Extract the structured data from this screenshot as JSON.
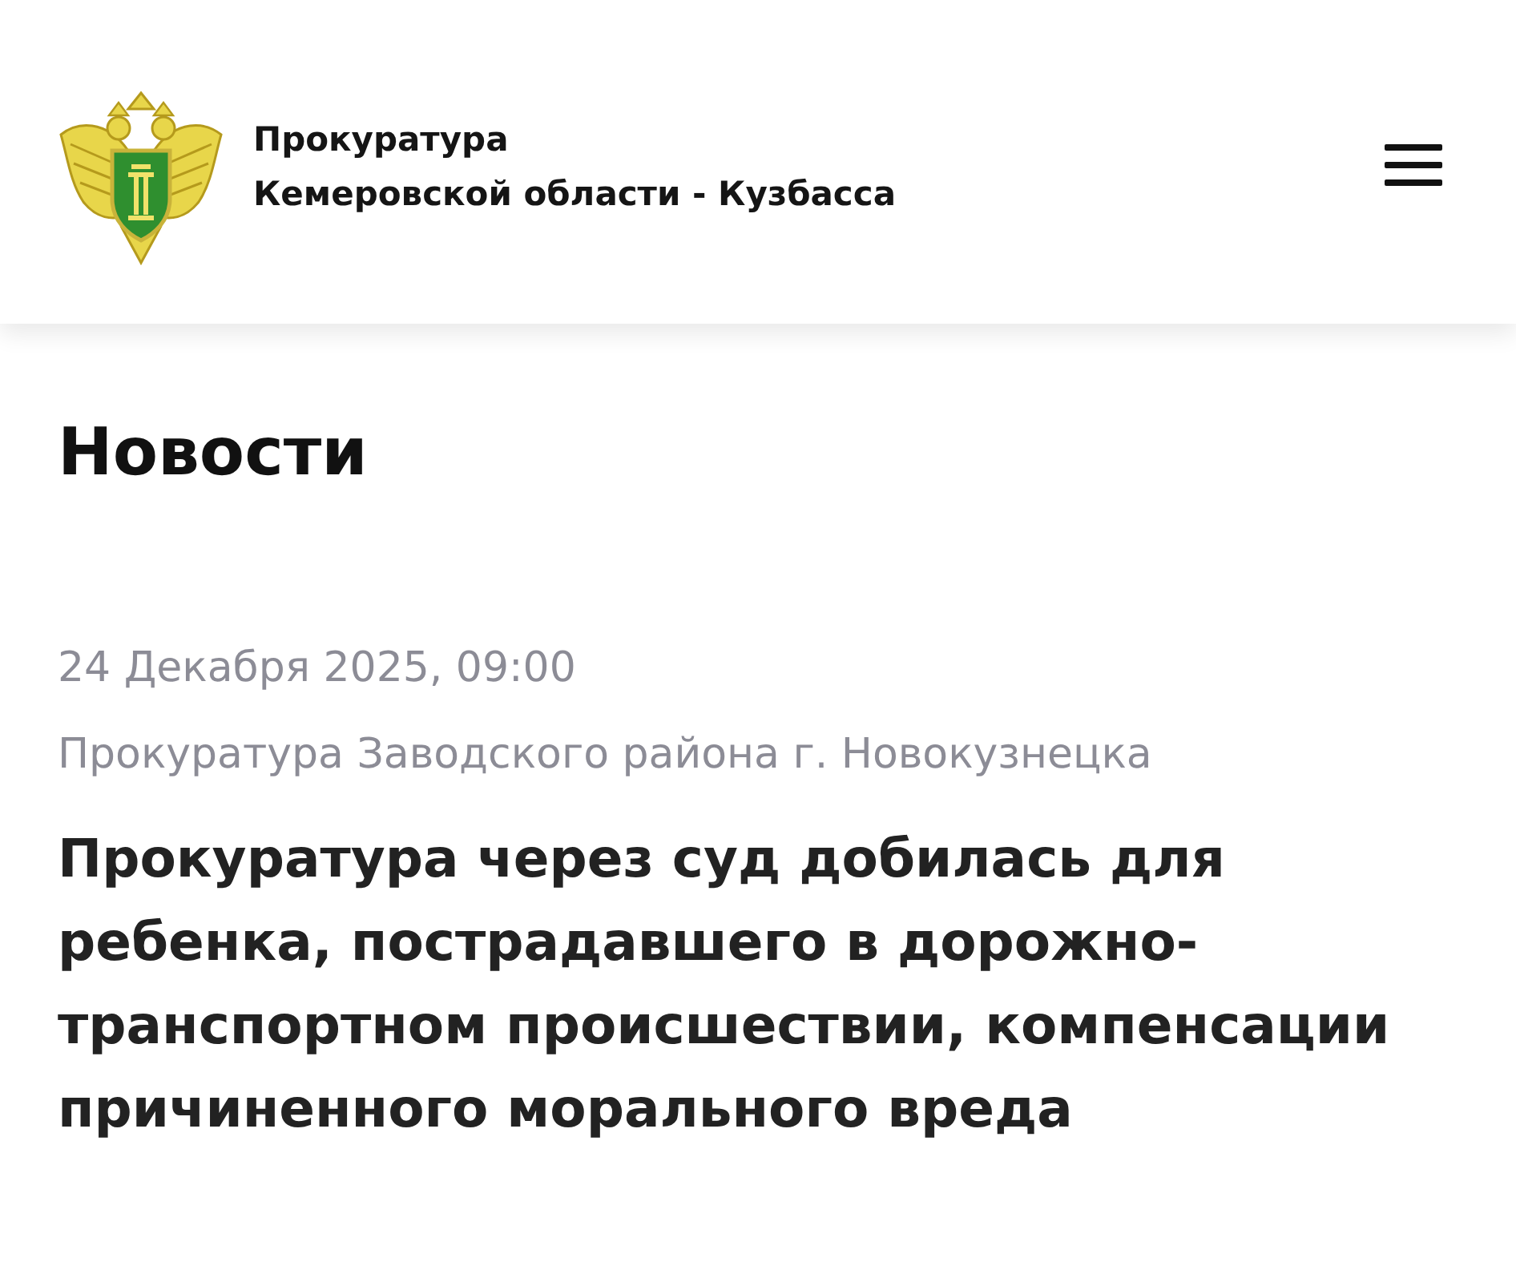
{
  "header": {
    "org_name": [
      "Прокуратура",
      "Кемеровской области - Кузбасса"
    ]
  },
  "page": {
    "title": "Новости"
  },
  "news": [
    {
      "date": "24 Декабря 2025, 09:00",
      "source": "Прокуратура Заводского района г. Новокузнецка",
      "headline": "Прокуратура через суд добилась для ребенка, пострадавшего в дорожно-транспортном происшествии, компенсации причиненного морального вреда"
    }
  ]
}
